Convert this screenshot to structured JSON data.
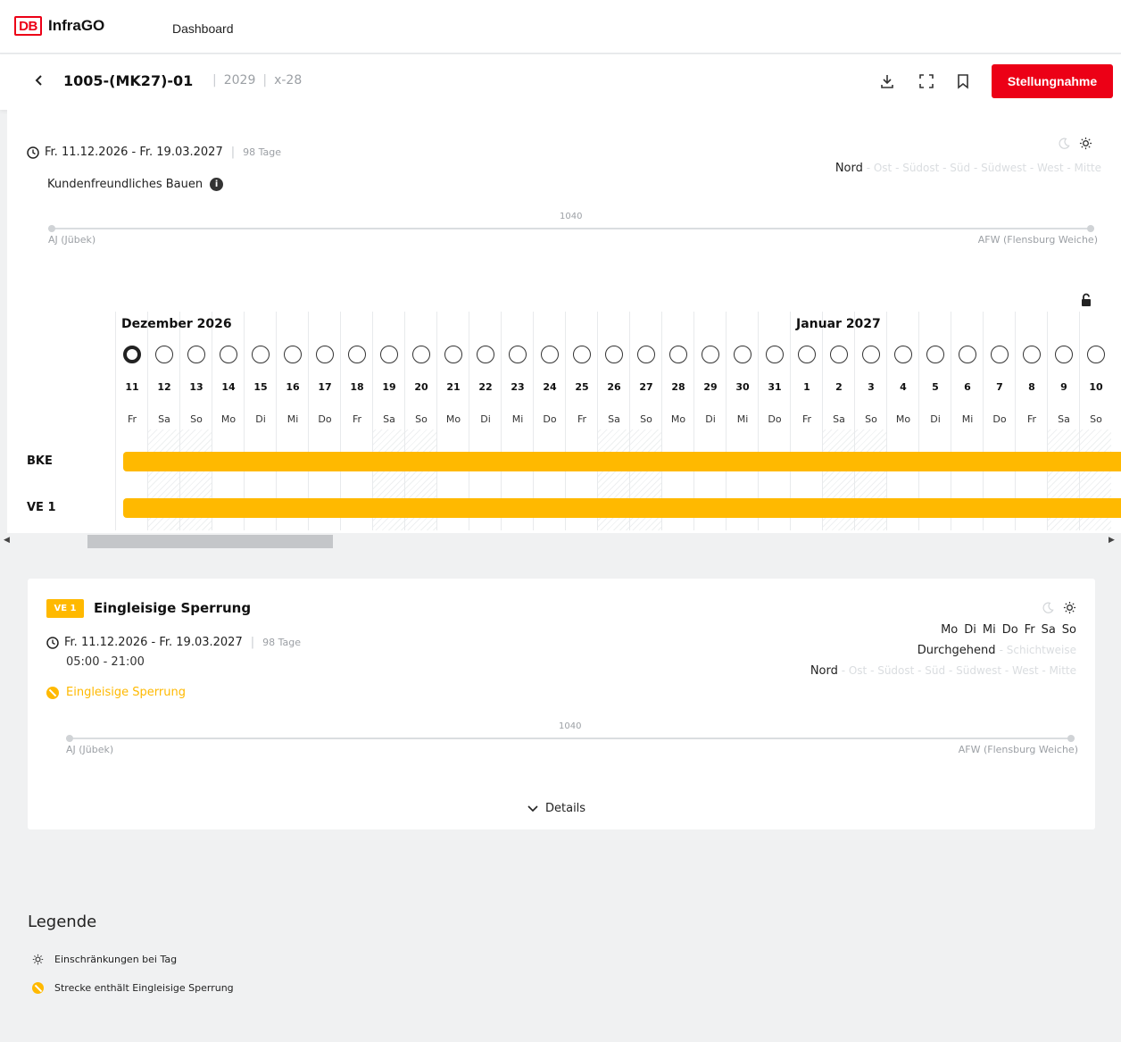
{
  "app": {
    "logo_text": "DB",
    "brand": "InfraGO",
    "nav_dashboard": "Dashboard"
  },
  "header": {
    "project_id": "1005-(MK27)-01",
    "year": "2029",
    "code": "x-28",
    "action_label": "Stellungnahme"
  },
  "overview": {
    "date_range": "Fr. 11.12.2026 - Fr. 19.03.2027",
    "days": "98 Tage",
    "note": "Kundenfreundliches Bauen",
    "directions_active": "Nord",
    "directions_inactive": "- Ost - Südost - Süd - Südwest - West - Mitte",
    "route": {
      "number": "1040",
      "start": "AJ (Jübek)",
      "end": "AFW (Flensburg Weiche)"
    }
  },
  "calendar": {
    "months": [
      {
        "label": "Dezember 2026",
        "start_index": 0
      },
      {
        "label": "Januar 2027",
        "start_index": 21
      }
    ],
    "days": [
      {
        "num": "11",
        "name": "Fr",
        "weekend": false,
        "selected": true
      },
      {
        "num": "12",
        "name": "Sa",
        "weekend": true
      },
      {
        "num": "13",
        "name": "So",
        "weekend": true
      },
      {
        "num": "14",
        "name": "Mo",
        "weekend": false
      },
      {
        "num": "15",
        "name": "Di",
        "weekend": false
      },
      {
        "num": "16",
        "name": "Mi",
        "weekend": false
      },
      {
        "num": "17",
        "name": "Do",
        "weekend": false
      },
      {
        "num": "18",
        "name": "Fr",
        "weekend": false
      },
      {
        "num": "19",
        "name": "Sa",
        "weekend": true
      },
      {
        "num": "20",
        "name": "So",
        "weekend": true
      },
      {
        "num": "21",
        "name": "Mo",
        "weekend": false
      },
      {
        "num": "22",
        "name": "Di",
        "weekend": false
      },
      {
        "num": "23",
        "name": "Mi",
        "weekend": false
      },
      {
        "num": "24",
        "name": "Do",
        "weekend": false
      },
      {
        "num": "25",
        "name": "Fr",
        "weekend": false
      },
      {
        "num": "26",
        "name": "Sa",
        "weekend": true
      },
      {
        "num": "27",
        "name": "So",
        "weekend": true
      },
      {
        "num": "28",
        "name": "Mo",
        "weekend": false
      },
      {
        "num": "29",
        "name": "Di",
        "weekend": false
      },
      {
        "num": "30",
        "name": "Mi",
        "weekend": false
      },
      {
        "num": "31",
        "name": "Do",
        "weekend": false
      },
      {
        "num": "1",
        "name": "Fr",
        "weekend": false
      },
      {
        "num": "2",
        "name": "Sa",
        "weekend": true
      },
      {
        "num": "3",
        "name": "So",
        "weekend": true
      },
      {
        "num": "4",
        "name": "Mo",
        "weekend": false
      },
      {
        "num": "5",
        "name": "Di",
        "weekend": false
      },
      {
        "num": "6",
        "name": "Mi",
        "weekend": false
      },
      {
        "num": "7",
        "name": "Do",
        "weekend": false
      },
      {
        "num": "8",
        "name": "Fr",
        "weekend": false
      },
      {
        "num": "9",
        "name": "Sa",
        "weekend": true
      },
      {
        "num": "10",
        "name": "So",
        "weekend": true
      }
    ],
    "rows": [
      {
        "label": "BKE",
        "color": "#ffb900"
      },
      {
        "label": "VE 1",
        "color": "#ffb900"
      }
    ]
  },
  "card": {
    "badge": "VE 1",
    "title": "Eingleisige Sperrung",
    "date_range": "Fr. 11.12.2026 - Fr. 19.03.2027",
    "days": "98 Tage",
    "time": "05:00 - 21:00",
    "warning": "Eingleisige Sperrung",
    "weekdays": [
      "Mo",
      "Di",
      "Mi",
      "Do",
      "Fr",
      "Sa",
      "So"
    ],
    "mode_active": "Durchgehend",
    "mode_inactive": "- Schichtweise",
    "directions_active": "Nord",
    "directions_inactive": "- Ost - Südost - Süd - Südwest - West - Mitte",
    "route": {
      "number": "1040",
      "start": "AJ (Jübek)",
      "end": "AFW (Flensburg Weiche)"
    },
    "details_label": "Details"
  },
  "legend": {
    "title": "Legende",
    "items": [
      {
        "icon": "sun-icon",
        "label": "Einschränkungen bei Tag"
      },
      {
        "icon": "single-track-icon",
        "label": "Strecke enthält Eingleisige Sperrung"
      }
    ]
  },
  "colors": {
    "brand_red": "#ec0016",
    "closure_yellow": "#ffb900"
  }
}
